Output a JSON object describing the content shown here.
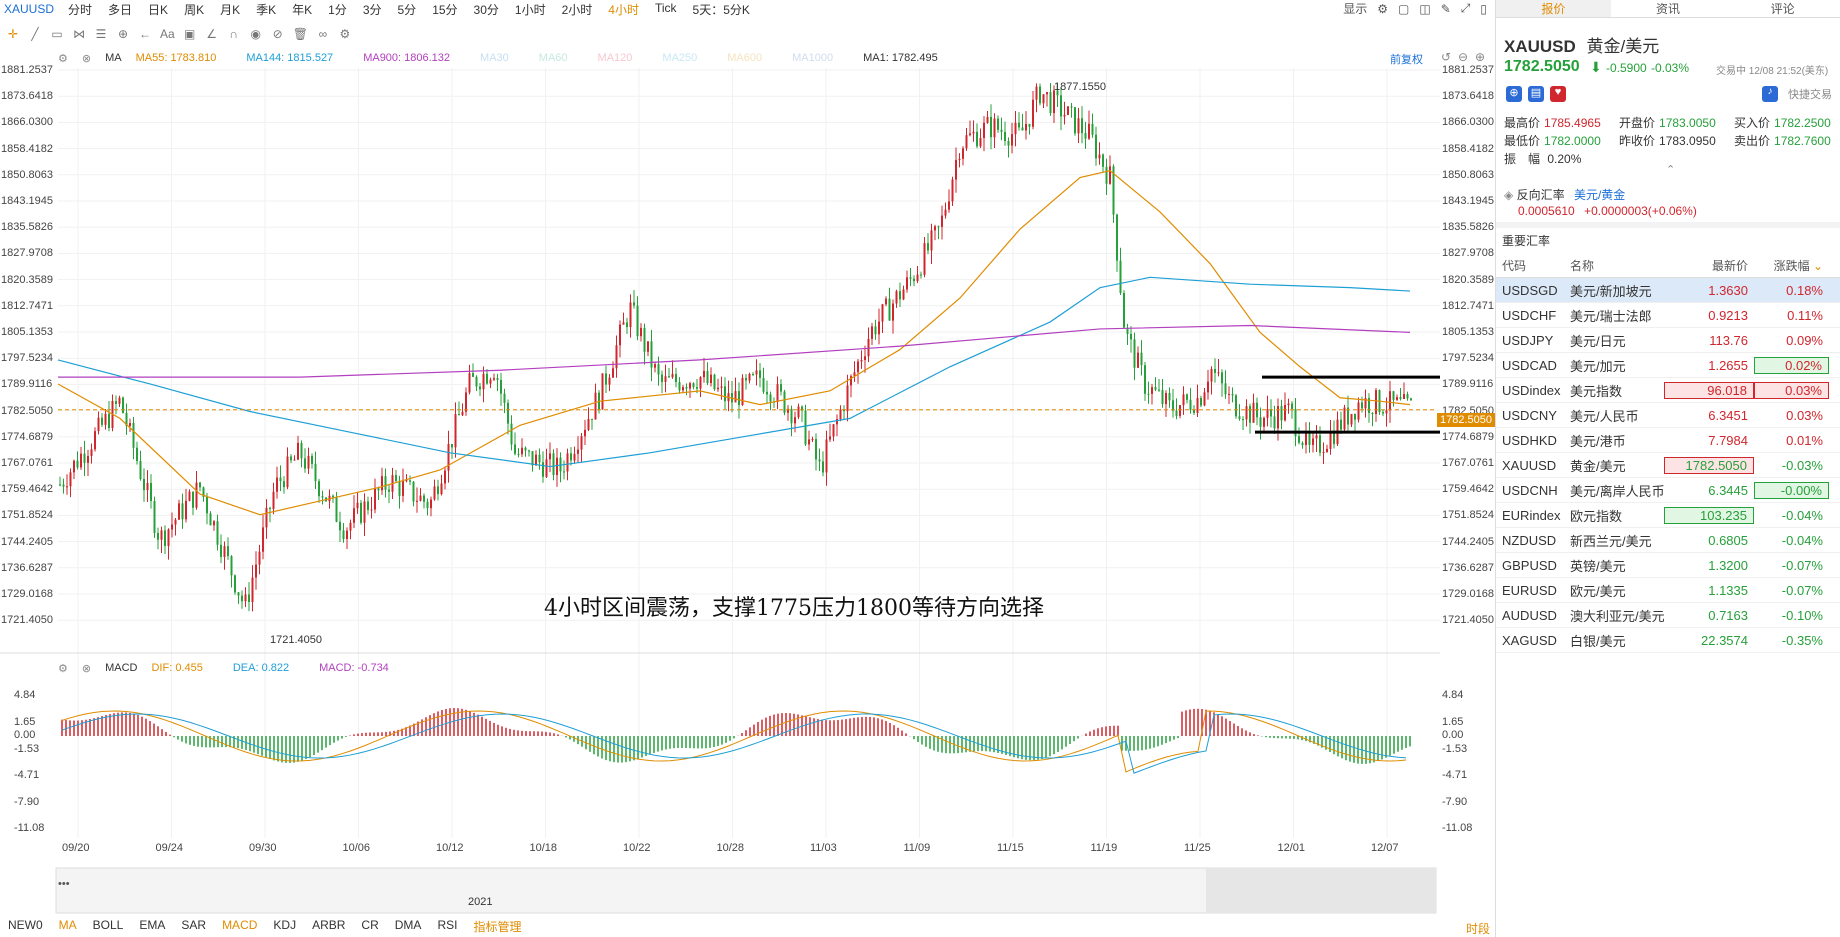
{
  "top": {
    "symbol": "XAUUSD",
    "timeframes": [
      "分时",
      "多日",
      "日K",
      "周K",
      "月K",
      "季K",
      "年K",
      "1分",
      "3分",
      "5分",
      "15分",
      "30分",
      "1小时",
      "2小时",
      "4小时",
      "Tick",
      "5天：5分K"
    ],
    "active_timeframe": "4小时",
    "display_label": "显示"
  },
  "toolbar": {
    "text_tool": "Aa"
  },
  "ma_row": {
    "title": "MA",
    "items": [
      {
        "label": "MA55: 1783.810",
        "color": "#e08c00"
      },
      {
        "label": "MA144: 1815.527",
        "color": "#1e9fd6"
      },
      {
        "label": "MA900: 1806.132",
        "color": "#b23fbf"
      },
      {
        "label": "MA30",
        "color": "#c6dff0"
      },
      {
        "label": "MA60",
        "color": "#c6e8e0"
      },
      {
        "label": "MA120",
        "color": "#f5c9d0"
      },
      {
        "label": "MA250",
        "color": "#c9e8f5"
      },
      {
        "label": "MA600",
        "color": "#f5e3c0"
      },
      {
        "label": "MA1000",
        "color": "#d0dcef"
      },
      {
        "label": "MA1: 1782.495",
        "color": "#333333"
      }
    ],
    "fq": "前复权"
  },
  "price_axis": [
    "1881.2537",
    "1873.6418",
    "1866.0300",
    "1858.4182",
    "1850.8063",
    "1843.1945",
    "1835.5826",
    "1827.9708",
    "1820.3589",
    "1812.7471",
    "1805.1353",
    "1797.5234",
    "1789.9116",
    "1782.5050",
    "1774.6879",
    "1767.0761",
    "1759.4642",
    "1751.8524",
    "1744.2405",
    "1736.6287",
    "1729.0168",
    "1721.4050"
  ],
  "current_price": "1782.5050",
  "annotations": {
    "high": "1877.1550",
    "low": "1721.4050",
    "comment": "4小时区间震荡，支撑1775压力1800等待方向选择"
  },
  "macd_row": {
    "title": "MACD",
    "items": [
      {
        "label": "DIF: 0.455",
        "color": "#e08c00"
      },
      {
        "label": "DEA: 0.822",
        "color": "#1e9fd6"
      },
      {
        "label": "MACD: -0.734",
        "color": "#b23fbf"
      }
    ]
  },
  "macd_axis": [
    "4.84",
    "1.65",
    "0.00",
    "-1.53",
    "-4.71",
    "-7.90",
    "-11.08"
  ],
  "date_axis": [
    "09/20",
    "09/24",
    "09/30",
    "10/06",
    "10/12",
    "10/18",
    "10/22",
    "10/28",
    "11/03",
    "11/09",
    "11/15",
    "11/19",
    "11/25",
    "12/01",
    "12/07"
  ],
  "year_label": "2021",
  "bottom_tabs": [
    "NEW0",
    "MA",
    "BOLL",
    "EMA",
    "SAR",
    "MACD",
    "KDJ",
    "ARBR",
    "CR",
    "DMA",
    "RSI",
    "指标管理"
  ],
  "bottom_right": "时段",
  "panel": {
    "tabs": [
      "报价",
      "资讯",
      "评论"
    ],
    "symbol": "XAUUSD",
    "name": "黄金/美元",
    "price": "1782.5050",
    "change": "-0.5900",
    "change_pct": "-0.03%",
    "status": "交易中 12/08 21:52(美东)",
    "quick_trade": "快捷交易",
    "stats": [
      {
        "label": "最高价",
        "value": "1785.4965",
        "cls": "up"
      },
      {
        "label": "开盘价",
        "value": "1783.0050",
        "cls": "dn"
      },
      {
        "label": "买入价",
        "value": "1782.2500",
        "cls": "dn"
      },
      {
        "label": "最低价",
        "value": "1782.0000",
        "cls": "dn"
      },
      {
        "label": "昨收价",
        "value": "1783.0950",
        "cls": ""
      },
      {
        "label": "卖出价",
        "value": "1782.7600",
        "cls": "dn"
      }
    ],
    "amplitude_label": "振　幅",
    "amplitude": "0.20%",
    "reverse_label": "反向汇率",
    "reverse_pair": "美元/黄金",
    "reverse_value": "0.0005610",
    "reverse_change": "+0.0000003(+0.06%)",
    "section_title": "重要汇率",
    "table_headers": [
      "代码",
      "名称",
      "最新价",
      "涨跌幅"
    ],
    "rows": [
      {
        "code": "USDSGD",
        "name": "美元/新加坡元",
        "price": "1.3630",
        "pct": "0.18%",
        "dir": "up",
        "sel": true,
        "box": ""
      },
      {
        "code": "USDCHF",
        "name": "美元/瑞士法郎",
        "price": "0.9213",
        "pct": "0.11%",
        "dir": "up",
        "sel": false,
        "box": ""
      },
      {
        "code": "USDJPY",
        "name": "美元/日元",
        "price": "113.76",
        "pct": "0.09%",
        "dir": "up",
        "sel": false,
        "box": ""
      },
      {
        "code": "USDCAD",
        "name": "美元/加元",
        "price": "1.2655",
        "pct": "0.02%",
        "dir": "up",
        "sel": false,
        "box": "pct-dn"
      },
      {
        "code": "USDindex",
        "name": "美元指数",
        "price": "96.018",
        "pct": "0.03%",
        "dir": "up",
        "sel": false,
        "box": "both-up"
      },
      {
        "code": "USDCNY",
        "name": "美元/人民币",
        "price": "6.3451",
        "pct": "0.03%",
        "dir": "up",
        "sel": false,
        "box": ""
      },
      {
        "code": "USDHKD",
        "name": "美元/港币",
        "price": "7.7984",
        "pct": "0.01%",
        "dir": "up",
        "sel": false,
        "box": ""
      },
      {
        "code": "XAUUSD",
        "name": "黄金/美元",
        "price": "1782.5050",
        "pct": "-0.03%",
        "dir": "dn",
        "sel": false,
        "box": "price-up"
      },
      {
        "code": "USDCNH",
        "name": "美元/离岸人民币",
        "price": "6.3445",
        "pct": "-0.00%",
        "dir": "dn",
        "sel": false,
        "box": "pct-dn"
      },
      {
        "code": "EURindex",
        "name": "欧元指数",
        "price": "103.235",
        "pct": "-0.04%",
        "dir": "dn",
        "sel": false,
        "box": "price-dn"
      },
      {
        "code": "NZDUSD",
        "name": "新西兰元/美元",
        "price": "0.6805",
        "pct": "-0.04%",
        "dir": "dn",
        "sel": false,
        "box": ""
      },
      {
        "code": "GBPUSD",
        "name": "英镑/美元",
        "price": "1.3200",
        "pct": "-0.07%",
        "dir": "dn",
        "sel": false,
        "box": ""
      },
      {
        "code": "EURUSD",
        "name": "欧元/美元",
        "price": "1.1335",
        "pct": "-0.07%",
        "dir": "dn",
        "sel": false,
        "box": ""
      },
      {
        "code": "AUDUSD",
        "name": "澳大利亚元/美元",
        "price": "0.7163",
        "pct": "-0.10%",
        "dir": "dn",
        "sel": false,
        "box": ""
      },
      {
        "code": "XAGUSD",
        "name": "白银/美元",
        "price": "22.3574",
        "pct": "-0.35%",
        "dir": "dn",
        "sel": false,
        "box": ""
      }
    ]
  },
  "colors": {
    "up": "#d0262d",
    "down": "#26a03a",
    "accent": "#e08c00",
    "link": "#1a6fd6"
  }
}
